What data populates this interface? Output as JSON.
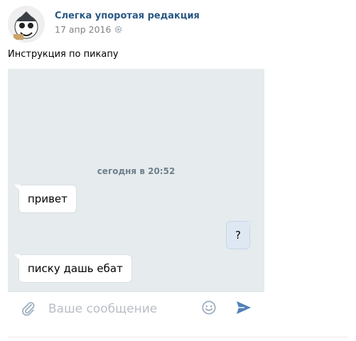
{
  "post": {
    "author": "Слегка упоротая редакция",
    "date": "17 апр 2016",
    "text": "Инструкция по пикапу"
  },
  "chat": {
    "date_label": "сегодня в 20:52",
    "messages": [
      {
        "text": "привет",
        "direction": "incoming"
      },
      {
        "text": "?",
        "direction": "outgoing"
      },
      {
        "text": "писку дашь ебат",
        "direction": "incoming"
      }
    ],
    "composer": {
      "placeholder": "Ваше сообщение"
    }
  },
  "icons": {
    "settings": "gear-icon",
    "attach": "paperclip-icon",
    "emoji": "smile-icon",
    "send": "send-icon"
  },
  "colors": {
    "author_link": "#2a5885",
    "chat_background": "#e6ebed",
    "incoming_bubble": "#ffffff",
    "outgoing_bubble": "#dde8f3",
    "send_icon": "#5181b8"
  }
}
